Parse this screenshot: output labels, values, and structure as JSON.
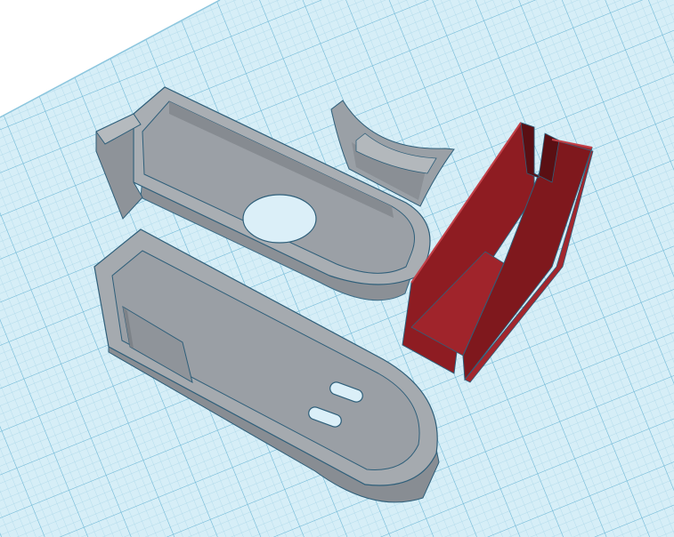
{
  "viewport": {
    "background_color": "#ffffff",
    "workplane_color": "#cfe9f4",
    "grid_fine_color": "#9fd2e6",
    "grid_major_color": "#6db6d4"
  },
  "objects": [
    {
      "name": "tray-with-round-hole",
      "color": "#9aa0a6",
      "hole": "circle"
    },
    {
      "name": "flat-base-plate",
      "color": "#9aa0a6",
      "slots": 2,
      "square-recess": true
    },
    {
      "name": "curved-bracket",
      "color": "#9aa0a6"
    },
    {
      "name": "red-channel-box",
      "color": "#8e1c22"
    }
  ]
}
